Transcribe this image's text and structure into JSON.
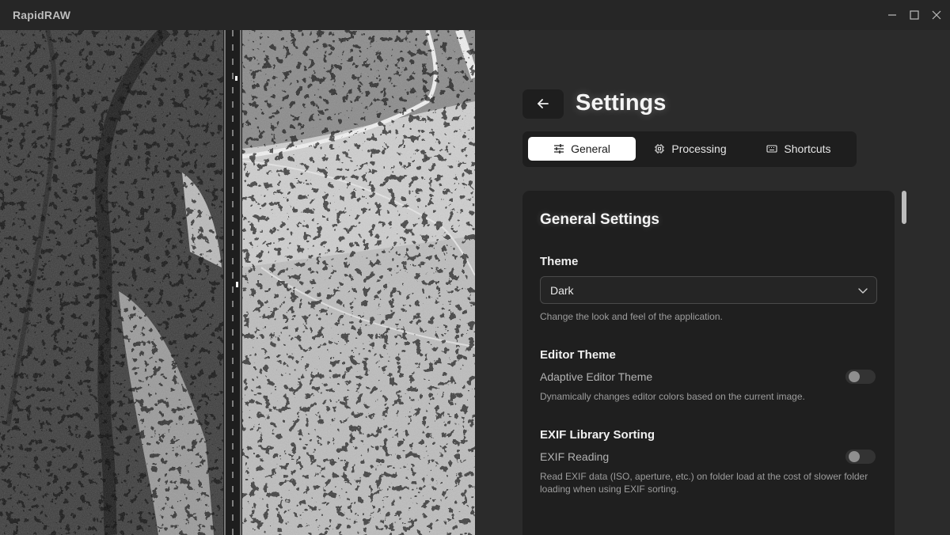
{
  "window": {
    "title": "RapidRAW",
    "controls": {
      "minimize_icon": "minimize-icon",
      "maximize_icon": "maximize-icon",
      "close_icon": "close-icon"
    }
  },
  "photo": {
    "description_icon": "image-preview"
  },
  "settings": {
    "back_icon": "arrow-left-icon",
    "title": "Settings",
    "tabs": [
      {
        "label": "General",
        "icon": "sliders-icon",
        "active": true
      },
      {
        "label": "Processing",
        "icon": "cpu-icon",
        "active": false
      },
      {
        "label": "Shortcuts",
        "icon": "keyboard-icon",
        "active": false
      }
    ],
    "section_title": "General Settings",
    "theme": {
      "label": "Theme",
      "selected": "Dark",
      "help": "Change the look and feel of the application."
    },
    "editor_theme": {
      "label": "Editor Theme",
      "toggle_label": "Adaptive Editor Theme",
      "enabled": false,
      "help": "Dynamically changes editor colors based on the current image."
    },
    "exif": {
      "label": "EXIF Library Sorting",
      "toggle_label": "EXIF Reading",
      "enabled": false,
      "help": "Read EXIF data (ISO, aperture, etc.) on folder load at the cost of slower folder loading when using EXIF sorting."
    }
  },
  "colors": {
    "background": "#2b2b2b",
    "panel": "#1f1f1f",
    "active_tab": "#ffffff",
    "text": "#f4f4f4",
    "muted_text": "#9d9d9d"
  }
}
